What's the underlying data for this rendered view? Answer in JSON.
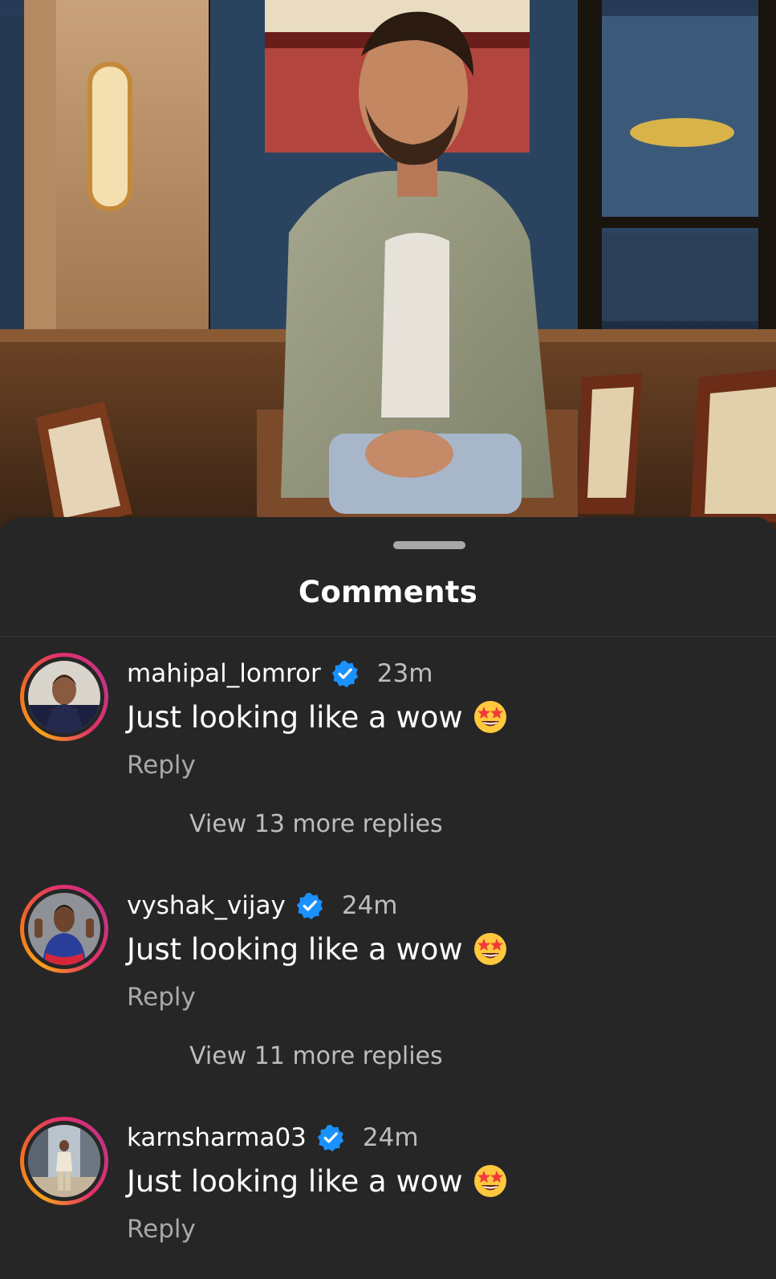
{
  "sheet": {
    "title": "Comments"
  },
  "comments": [
    {
      "username": "mahipal_lomror",
      "verified": true,
      "time": "23m",
      "text": "Just looking like a wow",
      "emoji": "star-struck-emoji",
      "reply_label": "Reply",
      "view_replies": "View 13 more replies"
    },
    {
      "username": "vyshak_vijay",
      "verified": true,
      "time": "24m",
      "text": "Just looking like a wow",
      "emoji": "star-struck-emoji",
      "reply_label": "Reply",
      "view_replies": "View 11 more replies"
    },
    {
      "username": "karnsharma03",
      "verified": true,
      "time": "24m",
      "text": "Just looking like a wow",
      "emoji": "star-struck-emoji",
      "reply_label": "Reply",
      "view_replies": ""
    }
  ],
  "colors": {
    "sheet_bg": "#262626",
    "verified_blue": "#1a91ff",
    "secondary_text": "#a8a8a8",
    "story_ring_start": "#f7a21b",
    "story_ring_end": "#c13584"
  }
}
